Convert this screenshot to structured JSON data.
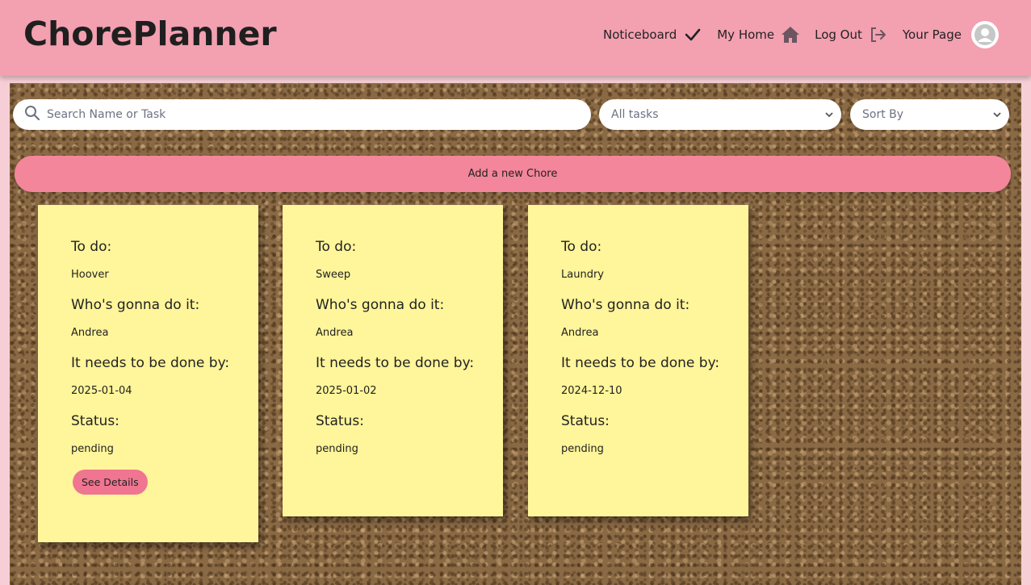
{
  "header": {
    "logo": "ChorePlanner",
    "nav": [
      {
        "label": "Noticeboard",
        "icon": "checkmark-icon"
      },
      {
        "label": "My Home",
        "icon": "home-icon"
      },
      {
        "label": "Log Out",
        "icon": "logout-icon"
      },
      {
        "label": "Your Page",
        "icon": "user-avatar-icon"
      }
    ]
  },
  "toolbar": {
    "search_placeholder": "Search Name or Task",
    "filter_value": "All tasks",
    "sort_value": "Sort By",
    "add_label": "Add a new Chore"
  },
  "labels": {
    "todo": "To do:",
    "who": "Who's gonna do it:",
    "due": "It needs to be done by:",
    "status": "Status:",
    "details": "See Details"
  },
  "chores": [
    {
      "task": "Hoover",
      "assignee": "Andrea",
      "due": "2025-01-04",
      "status": "pending"
    },
    {
      "task": "Sweep",
      "assignee": "Andrea",
      "due": "2025-01-02",
      "status": "pending"
    },
    {
      "task": "Laundry",
      "assignee": "Andrea",
      "due": "2024-12-10",
      "status": "pending"
    }
  ],
  "colors": {
    "header": "#f3a0b1",
    "accent": "#f3869a",
    "card": "#fff59a",
    "button": "#ef7590"
  }
}
